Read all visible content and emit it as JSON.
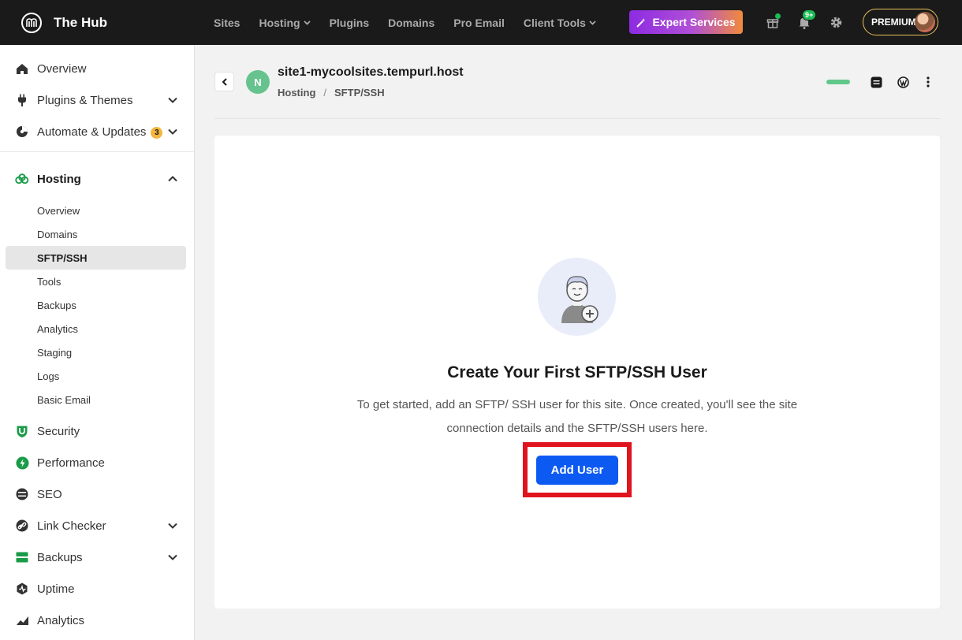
{
  "app": {
    "name": "The Hub"
  },
  "nav": {
    "items": [
      {
        "label": "Sites",
        "dropdown": false
      },
      {
        "label": "Hosting",
        "dropdown": true
      },
      {
        "label": "Plugins",
        "dropdown": false
      },
      {
        "label": "Domains",
        "dropdown": false
      },
      {
        "label": "Pro Email",
        "dropdown": false
      },
      {
        "label": "Client Tools",
        "dropdown": true
      }
    ],
    "expert_label": "Expert Services",
    "notification_count": "9+",
    "plan_label": "PREMIUM"
  },
  "sidebar": {
    "overview": "Overview",
    "plugins_themes": "Plugins & Themes",
    "automate": "Automate & Updates",
    "automate_count": "3",
    "hosting": "Hosting",
    "hosting_sub": [
      "Overview",
      "Domains",
      "SFTP/SSH",
      "Tools",
      "Backups",
      "Analytics",
      "Staging",
      "Logs",
      "Basic Email"
    ],
    "hosting_active": "SFTP/SSH",
    "security": "Security",
    "performance": "Performance",
    "seo": "SEO",
    "link_checker": "Link Checker",
    "backups": "Backups",
    "uptime": "Uptime",
    "analytics": "Analytics"
  },
  "header": {
    "site_initial": "N",
    "site_name": "site1-mycoolsites.tempurl.host",
    "breadcrumb_1": "Hosting",
    "breadcrumb_sep": "/",
    "breadcrumb_2": "SFTP/SSH"
  },
  "empty_state": {
    "title": "Create Your First SFTP/SSH User",
    "description": "To get started, add an SFTP/ SSH user for this site. Once created, you'll see the site connection details and the SFTP/SSH users here.",
    "button_label": "Add User"
  },
  "colors": {
    "topbar": "#1a1a1a",
    "accent_blue": "#0d5af3",
    "hub_green": "#1a9b48",
    "highlight_red": "#e0141e"
  }
}
